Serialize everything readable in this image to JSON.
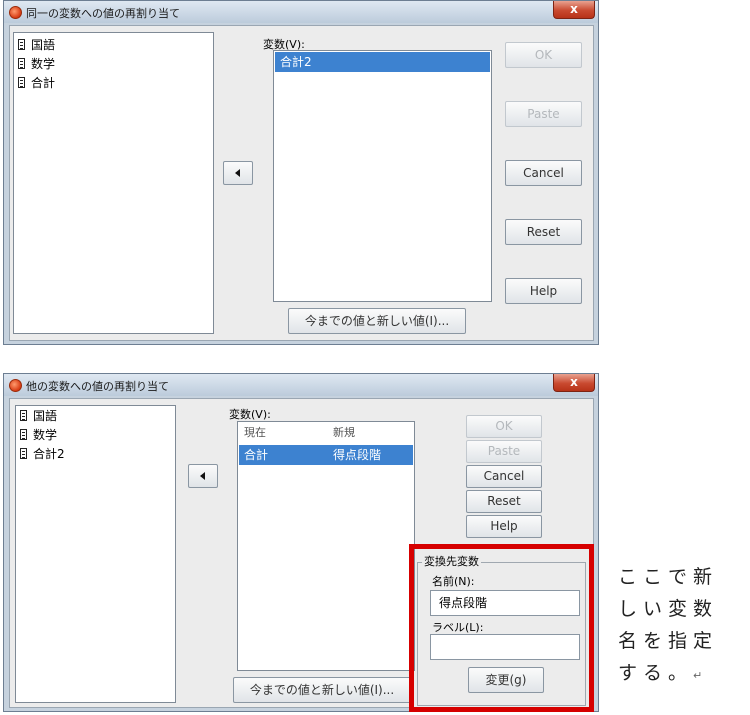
{
  "dialog1": {
    "title": "同一の変数への値の再割り当て",
    "close_label": "x",
    "variables": [
      "国語",
      "数学",
      "合計"
    ],
    "target_label": "変数(V):",
    "target_items": [
      "合計2"
    ],
    "buttons": {
      "ok": "OK",
      "paste": "Paste",
      "cancel": "Cancel",
      "reset": "Reset",
      "help": "Help"
    },
    "old_new_button": "今までの値と新しい値(I)..."
  },
  "dialog2": {
    "title": "他の変数への値の再割り当て",
    "close_label": "x",
    "variables": [
      "国語",
      "数学",
      "合計2"
    ],
    "target_label": "変数(V):",
    "columns": [
      "現在",
      "新規"
    ],
    "rows": [
      {
        "current": "合計",
        "new": "得点段階"
      }
    ],
    "buttons": {
      "ok": "OK",
      "paste": "Paste",
      "cancel": "Cancel",
      "reset": "Reset",
      "help": "Help"
    },
    "old_new_button": "今までの値と新しい値(I)...",
    "output_group": {
      "title": "変換先変数",
      "name_label": "名前(N):",
      "name_value": "得点段階",
      "label_label": "ラベル(L):",
      "label_value": "",
      "change_button": "変更(g)"
    }
  },
  "annotation": {
    "lines": [
      "ここで新",
      "しい変数",
      "名を指定",
      "する。"
    ],
    "end_mark": "↵",
    "highlight_color": "#d60000"
  }
}
